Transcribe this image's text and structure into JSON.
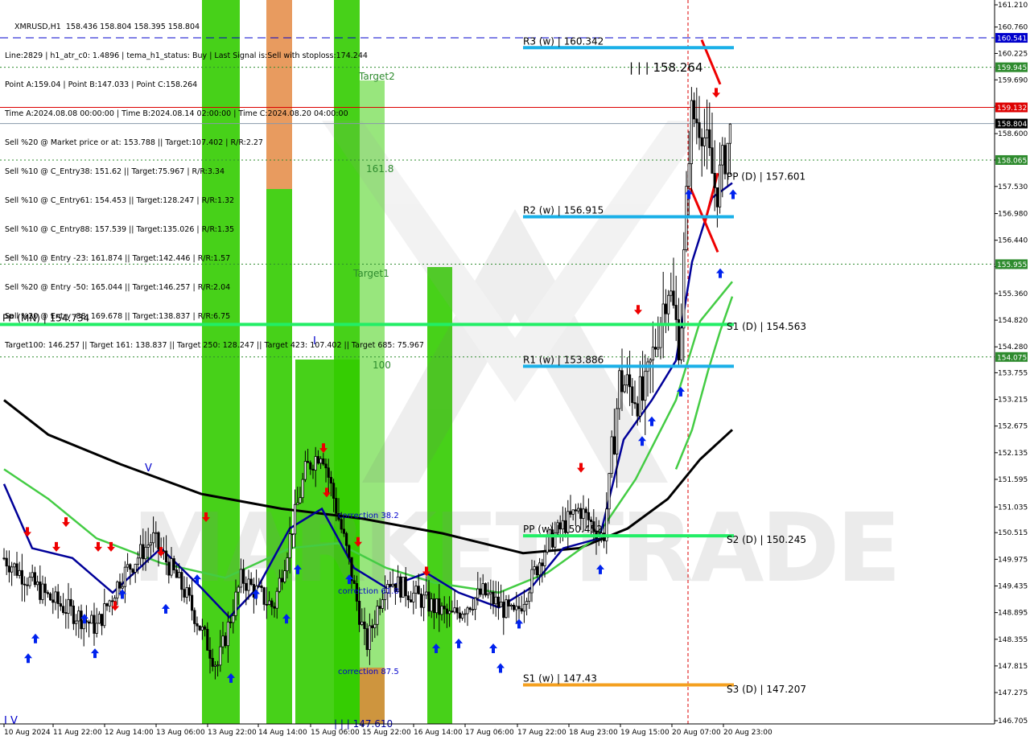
{
  "window": {
    "symbol_line": "XMRUSD,H1  158.436 158.804 158.395 158.804"
  },
  "info_lines": [
    "Line:2829 | h1_atr_c0: 1.4896 | tema_h1_status: Buy | Last Signal is:Sell with stoploss:174.244",
    "Point A:159.04 | Point B:147.033 | Point C:158.264",
    "Time A:2024.08.08 00:00:00 | Time B:2024.08.14 02:00:00 | Time C:2024.08.20 04:00:00",
    "Sell %20 @ Market price or at: 153.788 || Target:107.402 | R/R:2.27",
    "Sell %10 @ C_Entry38: 151.62 || Target:75.967 | R/R:3.34",
    "Sell %10 @ C_Entry61: 154.453 || Target:128.247 | R/R:1.32",
    "Sell %10 @ C_Entry88: 157.539 || Target:135.026 | R/R:1.35",
    "Sell %10 @ Entry -23: 161.874 || Target:142.446 | R/R:1.57",
    "Sell %20 @ Entry -50: 165.044 || Target:146.257 | R/R:2.04",
    "Sell %20 @ Entry -88: 169.678 || Target:138.837 | R/R:6.75",
    "Target100: 146.257 || Target 161: 138.837 || Target 250: 128.247 || Target 423: 107.402 || Target 685: 75.967"
  ],
  "chart_data": {
    "type": "candlestick",
    "symbol": "XMRUSD",
    "timeframe": "H1",
    "ylim": [
      146.705,
      161.21
    ],
    "price_ticks": [
      "161.210",
      "160.760",
      "160.225",
      "159.690",
      "159.155",
      "158.600",
      "158.065",
      "157.530",
      "156.980",
      "156.440",
      "155.905",
      "155.360",
      "154.820",
      "154.280",
      "153.755",
      "153.215",
      "152.675",
      "152.135",
      "151.595",
      "151.035",
      "150.515",
      "149.975",
      "149.435",
      "148.895",
      "148.355",
      "147.815",
      "147.275",
      "146.705"
    ],
    "time_ticks": [
      "10 Aug 2024",
      "11 Aug 22:00",
      "12 Aug 14:00",
      "13 Aug 06:00",
      "13 Aug 22:00",
      "14 Aug 14:00",
      "15 Aug 06:00",
      "15 Aug 22:00",
      "16 Aug 14:00",
      "17 Aug 06:00",
      "17 Aug 22:00",
      "18 Aug 23:00",
      "19 Aug 15:00",
      "20 Aug 07:00",
      "20 Aug 23:00"
    ],
    "price_badges": [
      {
        "value": "160.541",
        "price": 160.541,
        "color": "#0000cc",
        "text_color": "#ffffff"
      },
      {
        "value": "159.945",
        "price": 159.945,
        "color": "#2e8b2e",
        "text_color": "#ffffff"
      },
      {
        "value": "159.132",
        "price": 159.132,
        "color": "#dd0000",
        "text_color": "#ffffff"
      },
      {
        "value": "158.804",
        "price": 158.804,
        "color": "#000000",
        "text_color": "#ffffff"
      },
      {
        "value": "158.065",
        "price": 158.065,
        "color": "#2e8b2e",
        "text_color": "#ffffff"
      },
      {
        "value": "155.955",
        "price": 155.955,
        "color": "#2e8b2e",
        "text_color": "#ffffff"
      },
      {
        "value": "154.075",
        "price": 154.075,
        "color": "#2e8b2e",
        "text_color": "#ffffff"
      }
    ],
    "hlines": [
      {
        "price": 160.541,
        "color": "#0000cc",
        "style": "dash"
      },
      {
        "price": 159.945,
        "color": "#2e8b2e",
        "style": "dot"
      },
      {
        "price": 159.132,
        "color": "#dd0000",
        "style": "solid"
      },
      {
        "price": 158.804,
        "color": "#8899aa",
        "style": "solid"
      },
      {
        "price": 158.065,
        "color": "#2e8b2e",
        "style": "dot"
      },
      {
        "price": 155.955,
        "color": "#2e8b2e",
        "style": "dot"
      },
      {
        "price": 154.075,
        "color": "#2e8b2e",
        "style": "dot"
      }
    ],
    "pivot_levels": [
      {
        "label": "R3 (w) | 160.342",
        "price": 160.342,
        "color": "#1ab0e8",
        "x0": 0.508,
        "x1": 0.712
      },
      {
        "label": "R2 (w) | 156.915",
        "price": 156.915,
        "color": "#1ab0e8",
        "x0": 0.508,
        "x1": 0.712
      },
      {
        "label": "R1 (w) | 153.886",
        "price": 153.886,
        "color": "#1ab0e8",
        "x0": 0.508,
        "x1": 0.712
      },
      {
        "label": "PP (w) | 150.452",
        "price": 150.452,
        "color": "#22ee66",
        "x0": 0.508,
        "x1": 0.712
      },
      {
        "label": "S1 (w) | 147.43",
        "price": 147.43,
        "color": "#f4a020",
        "x0": 0.508,
        "x1": 0.712
      },
      {
        "label": "PP (MN) | 154.734",
        "price": 154.734,
        "color": "#22ee66",
        "x0": 0.0,
        "x1": 0.712
      },
      {
        "label": "PP (D) | 157.601",
        "price": 157.601,
        "color": "#000000",
        "x0": 0.0,
        "x1": 0.0
      },
      {
        "label": "S1 (D) | 154.563",
        "price": 154.563,
        "color": "#000000",
        "x0": 0.0,
        "x1": 0.0
      },
      {
        "label": "S2 (D) | 150.245",
        "price": 150.245,
        "color": "#000000",
        "x0": 0.0,
        "x1": 0.0
      },
      {
        "label": "S3 (D) | 147.207",
        "price": 147.207,
        "color": "#000000",
        "x0": 0.0,
        "x1": 0.0
      }
    ],
    "annotations": [
      "Target2",
      "Target1",
      "161.8",
      "100",
      "correction 38.2",
      "correction 61.8",
      "correction 87.5",
      "| | | 158.264",
      "| | | 147.610",
      "V",
      "I V",
      "I"
    ],
    "watermark": "MARKETTRADE"
  }
}
